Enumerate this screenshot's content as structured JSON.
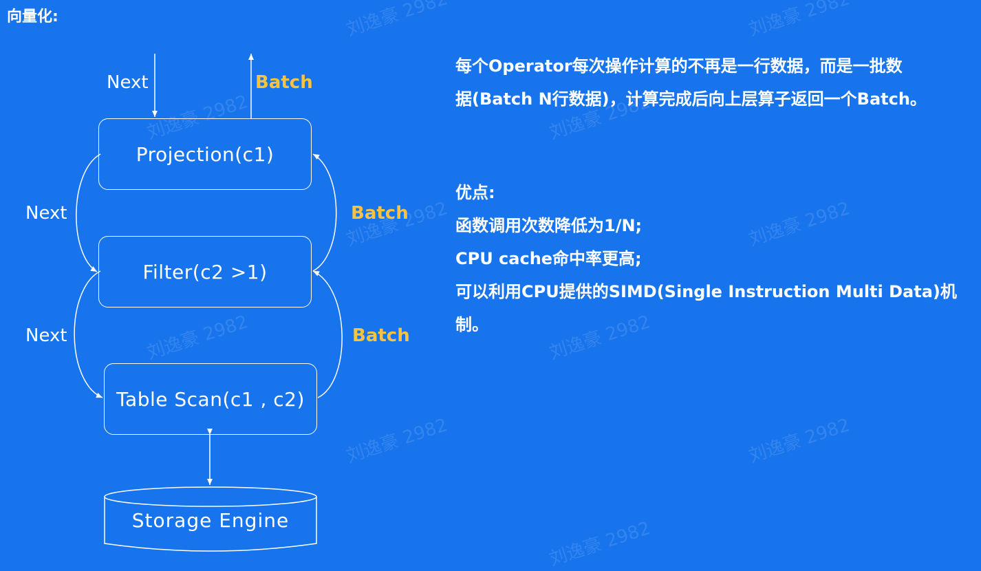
{
  "title": "向量化:",
  "nodes": {
    "projection": "Projection(c1)",
    "filter": "Filter(c2 >1)",
    "table_scan": "Table Scan(c1 , c2)",
    "storage": "Storage Engine"
  },
  "labels": {
    "next_top": "Next",
    "batch_top": "Batch",
    "next_mid": "Next",
    "batch_mid": "Batch",
    "next_low": "Next",
    "batch_low": "Batch"
  },
  "description": [
    "每个Operator每次操作计算的不再是一行数据，而是一批数",
    "据(Batch N行数据)，计算完成后向上层算子返回一个Batch。"
  ],
  "advantages": {
    "heading": "优点:",
    "items": [
      "函数调用次数降低为1/N;",
      "CPU cache命中率更高;",
      "可以利用CPU提供的SIMD(Single Instruction Multi Data)机",
      "制。"
    ]
  },
  "watermark": "刘逸豪 2982",
  "colors": {
    "background": "#1774ec",
    "batch_label": "#f6c343",
    "line": "#ffffff"
  }
}
